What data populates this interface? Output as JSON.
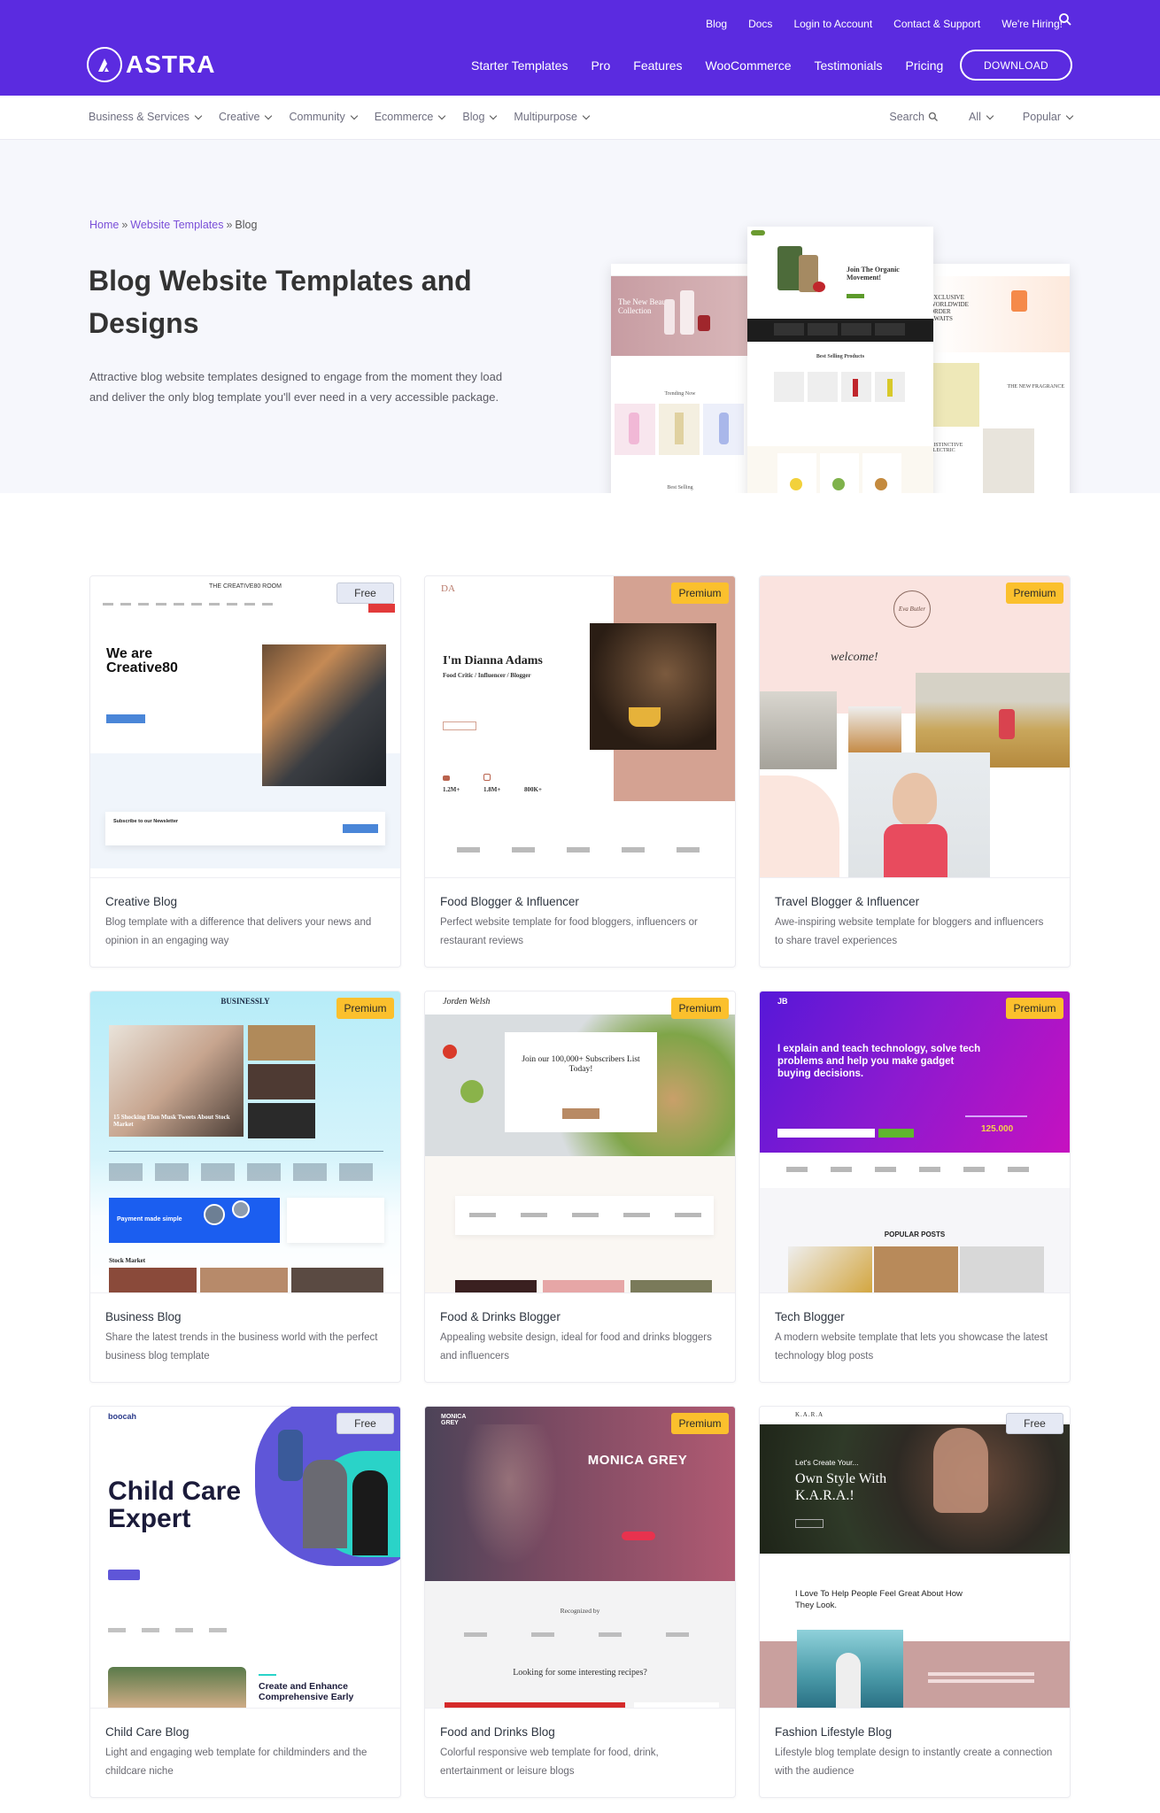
{
  "header": {
    "utility_links": [
      "Blog",
      "Docs",
      "Login to Account",
      "Contact & Support",
      "We're Hiring!"
    ],
    "logo_text": "ASTRA",
    "main_links": [
      "Starter Templates",
      "Pro",
      "Features",
      "WooCommerce",
      "Testimonials",
      "Pricing"
    ],
    "download_label": "DOWNLOAD",
    "brand_color": "#5b2be0"
  },
  "filters": {
    "categories": [
      "Business & Services",
      "Creative",
      "Community",
      "Ecommerce",
      "Blog",
      "Multipurpose"
    ],
    "search_label": "Search",
    "type_select": "All",
    "sort_select": "Popular"
  },
  "hero": {
    "breadcrumb": {
      "home": "Home",
      "section": "Website Templates",
      "current": "Blog",
      "separator": "»"
    },
    "title": "Blog Website Templates and Designs",
    "description": "Attractive blog website templates designed to engage from the moment they load and deliver the only blog template you'll ever need in a very accessible package.",
    "mockups": {
      "left": {
        "title": "The New Beauty Collection",
        "section": "Trending Now",
        "footer": "Best Selling"
      },
      "middle": {
        "title": "Join The Organic Movement!",
        "section": "Best Selling Products"
      },
      "right": {
        "title": "EXCLUSIVE WORLDWIDE ORDER AWAITS",
        "section": "THE NEW FRAGRANCE",
        "footer": "DISTINCTIVE ELECTRIC"
      }
    }
  },
  "templates": [
    {
      "title": "Creative Blog",
      "description": "Blog template with a difference that delivers your news and opinion in an engaging way",
      "badge": "Free",
      "preview": {
        "brand": "THE CREATIVE80 ROOM",
        "headline": "We are Creative80",
        "newsletter": "Subscribe to our Newsletter"
      }
    },
    {
      "title": "Food Blogger & Influencer",
      "description": "Perfect website template for food bloggers, influencers or restaurant reviews",
      "badge": "Premium",
      "preview": {
        "brand": "DA",
        "headline": "I'm Dianna Adams",
        "subline": "Food Critic / Influencer / Blogger",
        "stats": [
          "1.2M+",
          "1.8M+",
          "800K+"
        ]
      }
    },
    {
      "title": "Travel Blogger & Influencer",
      "description": "Awe-inspiring website template for bloggers and influencers to share travel experiences",
      "badge": "Premium",
      "preview": {
        "brand": "Eva Butler",
        "headline": "welcome!"
      }
    },
    {
      "title": "Business Blog",
      "description": "Share the latest trends in the business world with the perfect business blog template",
      "badge": "Premium",
      "preview": {
        "brand": "BUSINESSLY",
        "headline": "15 Shocking Elon Musk Tweets About Stock Market",
        "banner": "Payment made simple",
        "section": "Stock Market"
      }
    },
    {
      "title": "Food & Drinks Blogger",
      "description": "Appealing website design, ideal for food and drinks bloggers and influencers",
      "badge": "Premium",
      "preview": {
        "brand": "Jorden Welsh",
        "headline": "Join our 100,000+ Subscribers List Today!"
      }
    },
    {
      "title": "Tech Blogger",
      "description": "A modern website template that lets you showcase the latest technology blog posts",
      "badge": "Premium",
      "preview": {
        "brand": "JB",
        "headline": "I explain and teach technology, solve tech problems and help you make gadget buying decisions.",
        "stat": "125.000",
        "section": "POPULAR POSTS"
      }
    },
    {
      "title": "Child Care Blog",
      "description": "Light and engaging web template for childminders and the childcare niche",
      "badge": "Free",
      "preview": {
        "brand": "boocah",
        "headline": "Child Care Expert",
        "subline": "Create and Enhance Comprehensive Early"
      }
    },
    {
      "title": "Food and Drinks Blog",
      "description": "Colorful responsive web template for food, drink, entertainment or leisure blogs",
      "badge": "Premium",
      "preview": {
        "brand": "MONICA GREY",
        "headline": "MONICA GREY",
        "section": "Recognized by",
        "subline": "Looking for some interesting recipes?"
      }
    },
    {
      "title": "Fashion Lifestyle Blog",
      "description": "Lifestyle blog template design to instantly create a connection with the audience",
      "badge": "Free",
      "preview": {
        "brand": "K.A.R.A",
        "kicker": "Let's Create Your...",
        "headline": "Own Style With K.A.R.A.!",
        "subline": "I Love To Help People Feel Great About How They Look."
      }
    }
  ]
}
